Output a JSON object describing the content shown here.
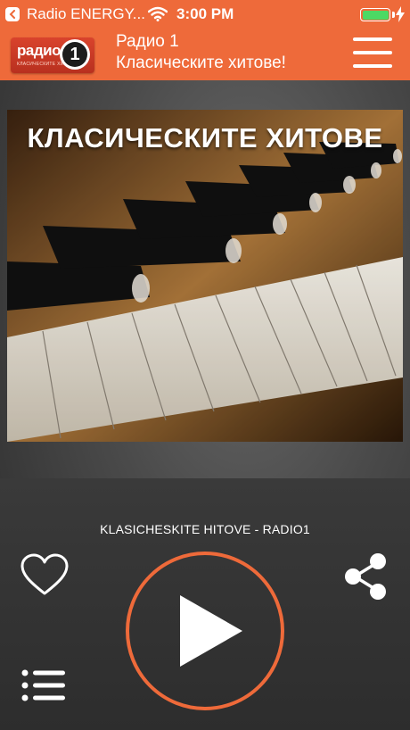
{
  "status_bar": {
    "app_name": "Radio ENERGY...",
    "time": "3:00 PM",
    "battery_color": "#4cd964"
  },
  "header": {
    "logo_word": "радио",
    "logo_number": "1",
    "logo_subtitle": "КЛАСИЧЕСКИТЕ ХИТОВЕ",
    "title": "Радио 1",
    "subtitle": "Класическите хитове!",
    "accent_color": "#ee6a3a"
  },
  "album_art": {
    "title": "КЛАСИЧЕСКИТЕ ХИТОВЕ"
  },
  "player": {
    "track": "KLASICHESKITE HITOVE - RADIO1",
    "icons": [
      "heart-icon",
      "play-icon",
      "share-icon",
      "list-icon"
    ]
  }
}
